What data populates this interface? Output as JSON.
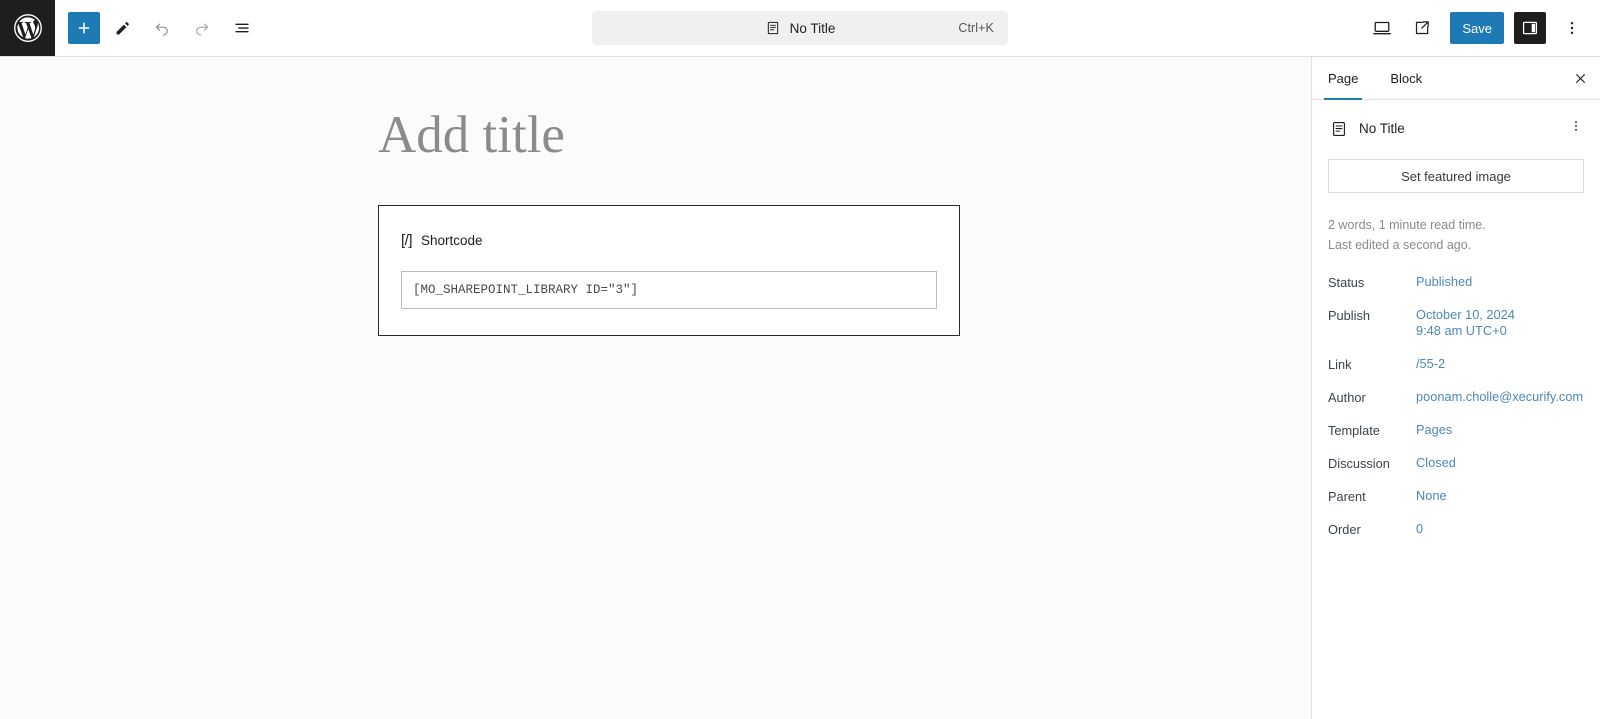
{
  "header": {
    "wp_logo": "wordpress-logo",
    "tools": [
      {
        "name": "add-block-button",
        "icon": "plus-icon",
        "label": "Toggle block inserter"
      },
      {
        "name": "tools-button",
        "icon": "pencil-icon",
        "label": "Tools"
      },
      {
        "name": "undo-button",
        "icon": "undo-icon",
        "label": "Undo"
      },
      {
        "name": "redo-button",
        "icon": "redo-icon",
        "label": "Redo"
      },
      {
        "name": "document-overview-button",
        "icon": "list-view-icon",
        "label": "Document Overview"
      }
    ],
    "command_bar": {
      "icon": "page-document-icon",
      "title": "No Title",
      "shortcut": "Ctrl+K"
    },
    "right": {
      "view_label": "View",
      "preview_label": "Preview",
      "save_label": "Save",
      "settings_label": "Settings",
      "options_label": "Options"
    }
  },
  "canvas": {
    "title_placeholder": "Add title",
    "block": {
      "icon_glyph": "[/]",
      "label": "Shortcode",
      "input_value": "[MO_SHAREPOINT_LIBRARY ID=\"3\"]"
    }
  },
  "sidebar": {
    "tabs": [
      {
        "label": "Page",
        "active": true
      },
      {
        "label": "Block",
        "active": false
      }
    ],
    "close_label": "Close settings",
    "document": {
      "icon": "page-document-icon",
      "title": "No Title",
      "menu_label": "Actions"
    },
    "featured_image_button": "Set featured image",
    "meta": {
      "word_count": "2 words, 1 minute read time.",
      "last_edited": "Last edited a second ago."
    },
    "rows": [
      {
        "label": "Status",
        "value": "Published"
      },
      {
        "label": "Publish",
        "value": "October 10, 2024\n9:48 am UTC+0"
      },
      {
        "label": "Link",
        "value": "/55-2"
      },
      {
        "label": "Author",
        "value": "poonam.cholle@xecurify.com"
      },
      {
        "label": "Template",
        "value": "Pages"
      },
      {
        "label": "Discussion",
        "value": "Closed"
      },
      {
        "label": "Parent",
        "value": "None"
      },
      {
        "label": "Order",
        "value": "0"
      }
    ]
  },
  "colors": {
    "accent": "#1e7ab5",
    "link": "#4f87b5",
    "dark": "#1e1e1e",
    "canvas": "#fbfbfb"
  }
}
